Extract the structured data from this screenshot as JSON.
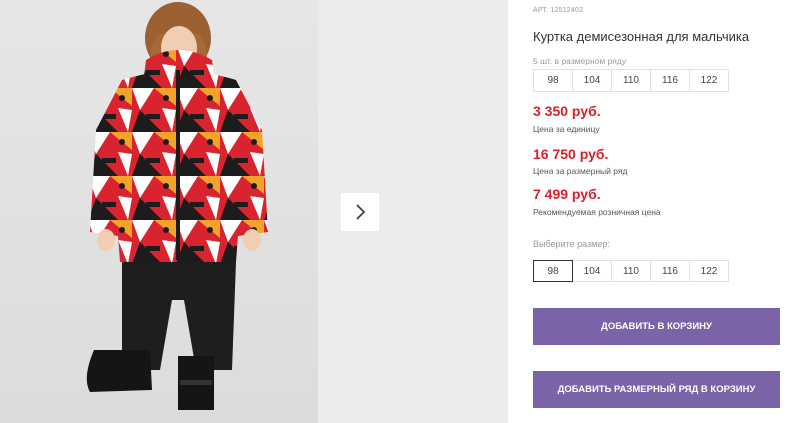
{
  "product": {
    "article": "АРТ. 12512402",
    "title": "Куртка демисезонная для мальчика",
    "pack_note": "5 шт. в размерном ряду",
    "pack_sizes": [
      "98",
      "104",
      "110",
      "116",
      "122"
    ]
  },
  "prices": {
    "unit_price": "3 350 руб.",
    "unit_label": "Цена за единицу",
    "pack_price": "16 750 руб.",
    "pack_label": "Цена за размерный ряд",
    "retail_price": "7 499 руб.",
    "retail_label": "Рекомендуемая розничная цена"
  },
  "size_select": {
    "label": "Выберите размер:",
    "sizes": [
      "98",
      "104",
      "110",
      "116",
      "122"
    ],
    "selected": "98"
  },
  "actions": {
    "add_to_cart": "ДОБАВИТЬ В КОРЗИНУ",
    "add_pack_to_cart": "ДОБАВИТЬ РАЗМЕРНЫЙ РЯД В КОРЗИНУ"
  },
  "colors": {
    "price_red": "#d8202a",
    "button_purple": "#7b63a8",
    "jacket_red": "#d9232e",
    "jacket_orange": "#f2a32a"
  },
  "gallery": {
    "next_icon": "chevron-right-icon"
  }
}
